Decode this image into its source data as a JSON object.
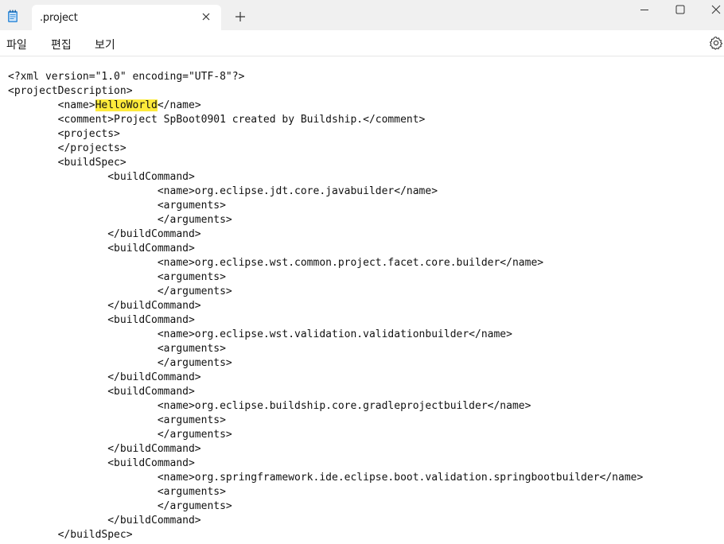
{
  "app": {
    "tab_title": ".project",
    "icon": "notepad-icon"
  },
  "menu": {
    "file": "파일",
    "edit": "편집",
    "view": "보기"
  },
  "editor": {
    "highlight_word": "HelloWorld",
    "highlight_color": "#ffeb3b",
    "lines": [
      "<?xml version=\"1.0\" encoding=\"UTF-8\"?>",
      "<projectDescription>",
      "\t<name>HelloWorld</name>",
      "\t<comment>Project SpBoot0901 created by Buildship.</comment>",
      "\t<projects>",
      "\t</projects>",
      "\t<buildSpec>",
      "\t\t<buildCommand>",
      "\t\t\t<name>org.eclipse.jdt.core.javabuilder</name>",
      "\t\t\t<arguments>",
      "\t\t\t</arguments>",
      "\t\t</buildCommand>",
      "\t\t<buildCommand>",
      "\t\t\t<name>org.eclipse.wst.common.project.facet.core.builder</name>",
      "\t\t\t<arguments>",
      "\t\t\t</arguments>",
      "\t\t</buildCommand>",
      "\t\t<buildCommand>",
      "\t\t\t<name>org.eclipse.wst.validation.validationbuilder</name>",
      "\t\t\t<arguments>",
      "\t\t\t</arguments>",
      "\t\t</buildCommand>",
      "\t\t<buildCommand>",
      "\t\t\t<name>org.eclipse.buildship.core.gradleprojectbuilder</name>",
      "\t\t\t<arguments>",
      "\t\t\t</arguments>",
      "\t\t</buildCommand>",
      "\t\t<buildCommand>",
      "\t\t\t<name>org.springframework.ide.eclipse.boot.validation.springbootbuilder</name>",
      "\t\t\t<arguments>",
      "\t\t\t</arguments>",
      "\t\t</buildCommand>",
      "\t</buildSpec>"
    ]
  }
}
